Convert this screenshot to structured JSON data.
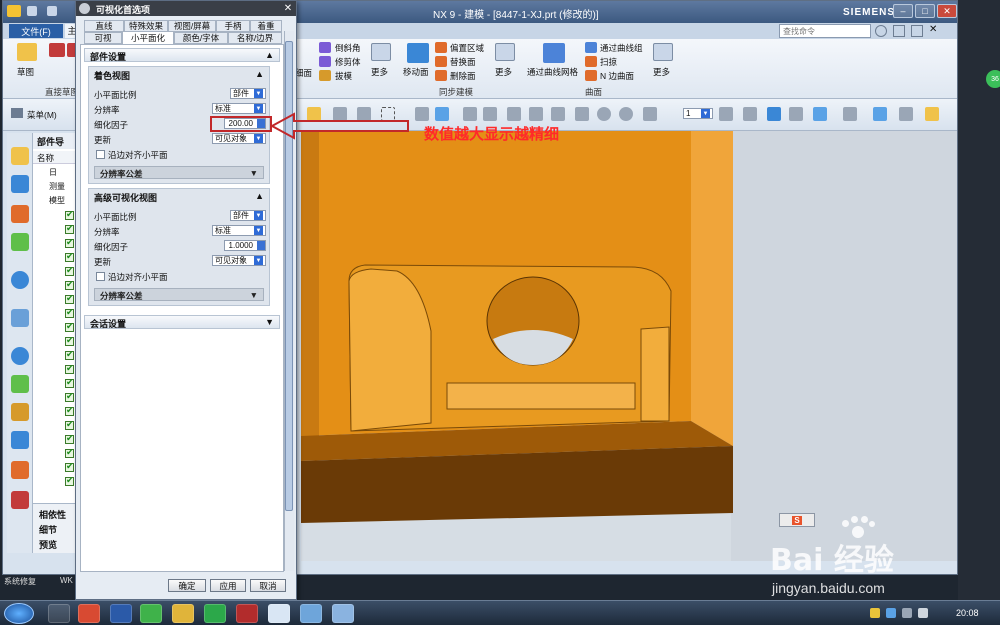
{
  "window": {
    "title": "NX 9 - 建模 - [8447-1-XJ.prt  (修改的)]",
    "brand": "SIEMENS"
  },
  "menubar": {
    "file_tab": "文件(F)",
    "home_tab_fragment": "主",
    "search_placeholder": "查找命令"
  },
  "ribbon": {
    "sketch": "草图",
    "direct_sketch": "直接草图",
    "items_a": [
      "倒斜角",
      "修剪体",
      "拔模"
    ],
    "more": "更多",
    "move_face": "移动面",
    "items_b": [
      "偏置区域",
      "替换面",
      "删除面"
    ],
    "sync_group": "同步建模",
    "curve_mesh": "通过曲线网格",
    "items_c": [
      "通过曲线组",
      "扫掠",
      "N 边曲面"
    ],
    "surface_group": "曲面",
    "face_fragment": "细面"
  },
  "toolbar2": {
    "menu": "菜单(M)",
    "spin_value": "1"
  },
  "navigator": {
    "title": "部件导",
    "column": "名称",
    "tree": [
      "日",
      "测量",
      "模型"
    ],
    "bottom": [
      "相依性",
      "细节",
      "预览"
    ]
  },
  "dialog": {
    "title": "可视化首选项",
    "tabs_row1": [
      "直线",
      "特殊效果",
      "视图/屏幕",
      "手柄",
      "着重"
    ],
    "tabs_row2": [
      "可视",
      "小平面化",
      "颜色/字体",
      "名称/边界"
    ],
    "active_tab": "小平面化",
    "part_settings": "部件设置",
    "shaded_view": {
      "title": "着色视图",
      "facet_ratio_label": "小平面比例",
      "facet_ratio_value": "部件",
      "resolution_label": "分辨率",
      "resolution_value": "标准",
      "refine_label": "细化因子",
      "refine_value": "200.00",
      "update_label": "更新",
      "update_value": "可见对象",
      "align_label": "沿边对齐小平面",
      "tolerance_bar": "分辨率公差"
    },
    "advanced_view": {
      "title": "高级可视化视图",
      "facet_ratio_label": "小平面比例",
      "facet_ratio_value": "部件",
      "resolution_label": "分辨率",
      "resolution_value": "标准",
      "refine_label": "细化因子",
      "refine_value": "1.0000",
      "update_label": "更新",
      "update_value": "可见对象",
      "align_label": "沿边对齐小平面",
      "tolerance_bar": "分辨率公差"
    },
    "session_settings": "会话设置",
    "buttons": [
      "确定",
      "应用",
      "取消"
    ]
  },
  "annotation": "数值越大显示越精细",
  "taskbar": {
    "clock": "20:08",
    "left_fragment": "系统修复",
    "wk_fragment": "WK"
  },
  "watermark": {
    "logo": "Bai 经验",
    "url": "jingyan.baidu.com"
  },
  "colors": {
    "model_orange": "#e8901a",
    "annotation_red": "#ff2a2a",
    "title_blue": "#3c5980"
  }
}
